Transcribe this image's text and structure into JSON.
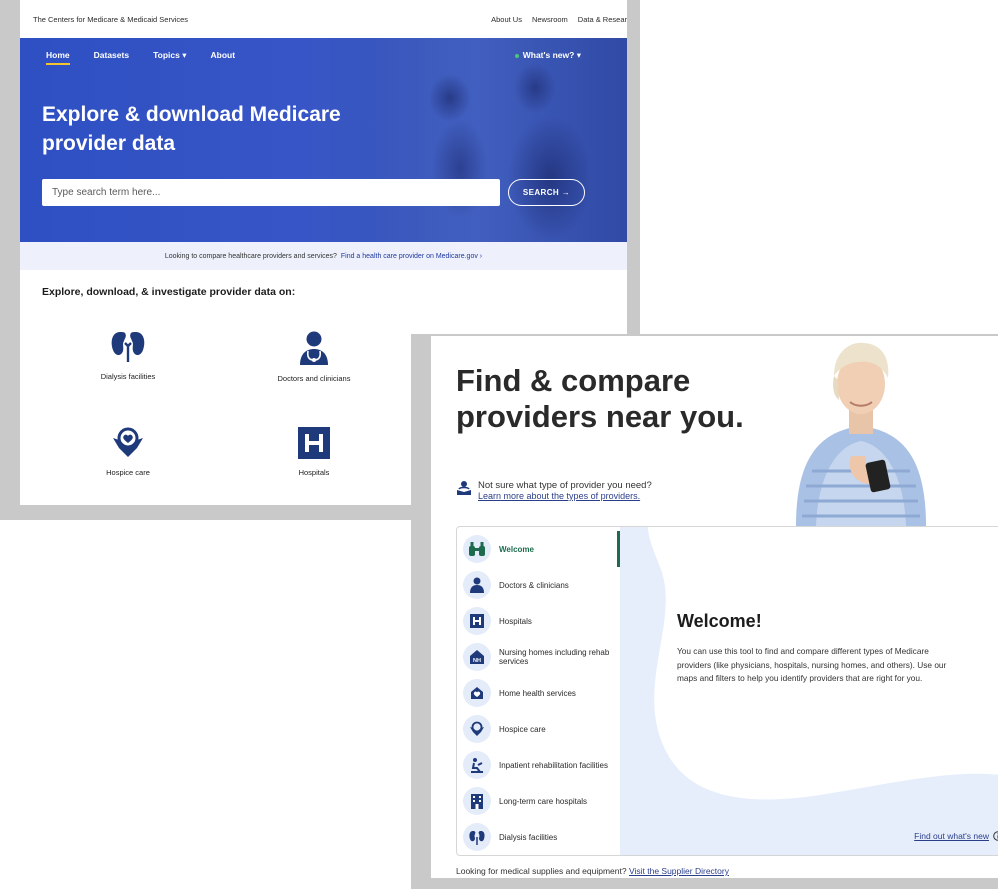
{
  "provider_site": {
    "agency": "The Centers for Medicare & Medicaid Services",
    "top_links": [
      "About Us",
      "Newsroom",
      "Data & Resear"
    ],
    "nav": {
      "home": "Home",
      "datasets": "Datasets",
      "topics": "Topics",
      "about": "About",
      "whats_new": "What's new?"
    },
    "hero_title": "Explore & download Medicare provider data",
    "search": {
      "placeholder": "Type search term here...",
      "button": "SEARCH"
    },
    "compare_text": "Looking to compare healthcare providers and services?",
    "compare_link": "Find a health care provider on Medicare.gov",
    "explore_title": "Explore, download, & investigate provider data on:",
    "tiles": [
      "Dialysis facilities",
      "Doctors and clinicians",
      "Hospice care",
      "Hospitals"
    ]
  },
  "compare_site": {
    "title": "Find & compare providers near you.",
    "help_question": "Not sure what type of provider you need?",
    "help_link": "Learn more about the types of providers.",
    "sidebar": [
      {
        "label": "Welcome",
        "icon": "binoculars-icon"
      },
      {
        "label": "Doctors & clinicians",
        "icon": "doctor-icon"
      },
      {
        "label": "Hospitals",
        "icon": "hospital-icon"
      },
      {
        "label": "Nursing homes including rehab services",
        "icon": "nursing-home-icon"
      },
      {
        "label": "Home health services",
        "icon": "home-health-icon"
      },
      {
        "label": "Hospice care",
        "icon": "hospice-icon"
      },
      {
        "label": "Inpatient rehabilitation facilities",
        "icon": "rehab-icon"
      },
      {
        "label": "Long-term care hospitals",
        "icon": "building-icon"
      },
      {
        "label": "Dialysis facilities",
        "icon": "kidney-icon"
      }
    ],
    "welcome_heading": "Welcome!",
    "welcome_body": "You can use this tool to find and compare different types of Medicare providers (like physicians, hospitals, nursing homes, and others). Use our maps and filters to help you identify providers that are right for you.",
    "find_out": "Find out what's new",
    "supplier_text": "Looking for medical supplies and equipment?",
    "supplier_link": "Visit the Supplier Directory"
  },
  "colors": {
    "brand_blue": "#2f50c0",
    "navy": "#1f3a7a",
    "green": "#1d6b4c",
    "accent_yellow": "#f4c430"
  }
}
